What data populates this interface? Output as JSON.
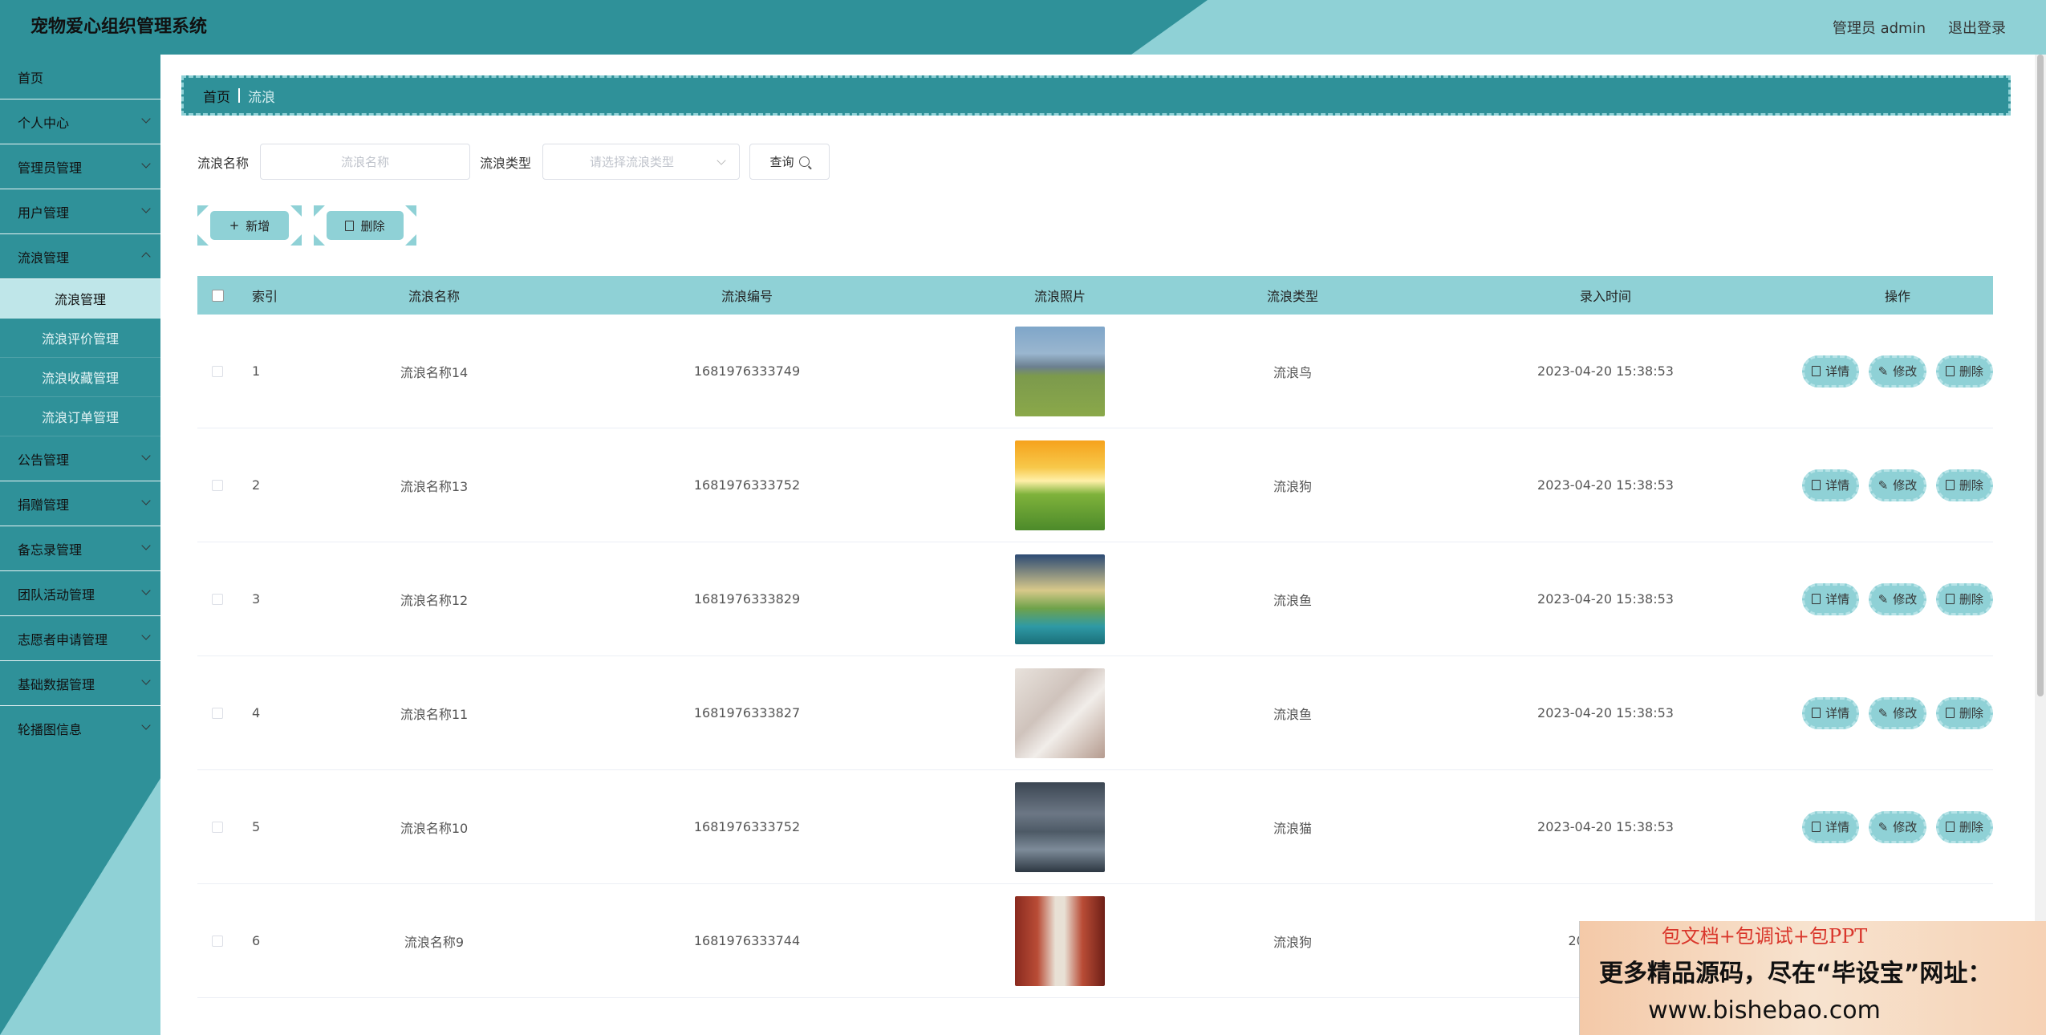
{
  "header": {
    "title": "宠物爱心组织管理系统",
    "user": "管理员 admin",
    "logout": "退出登录"
  },
  "sidebar": {
    "items": [
      {
        "label": "首页"
      },
      {
        "label": "个人中心"
      },
      {
        "label": "管理员管理"
      },
      {
        "label": "用户管理"
      },
      {
        "label": "流浪管理"
      }
    ],
    "sub_items": [
      {
        "label": "流浪管理"
      },
      {
        "label": "流浪评价管理"
      },
      {
        "label": "流浪收藏管理"
      },
      {
        "label": "流浪订单管理"
      }
    ],
    "items_after": [
      {
        "label": "公告管理"
      },
      {
        "label": "捐赠管理"
      },
      {
        "label": "备忘录管理"
      },
      {
        "label": "团队活动管理"
      },
      {
        "label": "志愿者申请管理"
      },
      {
        "label": "基础数据管理"
      },
      {
        "label": "轮播图信息"
      }
    ]
  },
  "breadcrumb": {
    "home": "首页",
    "current": "流浪"
  },
  "search": {
    "name_label": "流浪名称",
    "name_placeholder": "流浪名称",
    "type_label": "流浪类型",
    "type_placeholder": "请选择流浪类型",
    "query_label": "查询"
  },
  "actions": {
    "add_label": "新增",
    "delete_label": "删除"
  },
  "table": {
    "headers": [
      "索引",
      "流浪名称",
      "流浪编号",
      "流浪照片",
      "流浪类型",
      "录入时间",
      "操作"
    ],
    "op_labels": {
      "detail": "详情",
      "edit": "修改",
      "delete": "删除"
    },
    "rows": [
      {
        "idx": "1",
        "name": "流浪名称14",
        "code": "1681976333749",
        "type": "流浪鸟",
        "time": "2023-04-20 15:38:53",
        "img": "mountain-meadow"
      },
      {
        "idx": "2",
        "name": "流浪名称13",
        "code": "1681976333752",
        "type": "流浪狗",
        "time": "2023-04-20 15:38:53",
        "img": "sunset-flowers"
      },
      {
        "idx": "3",
        "name": "流浪名称12",
        "code": "1681976333829",
        "type": "流浪鱼",
        "time": "2023-04-20 15:38:53",
        "img": "lake-sunrise"
      },
      {
        "idx": "4",
        "name": "流浪名称11",
        "code": "1681976333827",
        "type": "流浪鱼",
        "time": "2023-04-20 15:38:53",
        "img": "blossom-branch"
      },
      {
        "idx": "5",
        "name": "流浪名称10",
        "code": "1681976333752",
        "type": "流浪猫",
        "time": "2023-04-20 15:38:53",
        "img": "lakeside-town"
      },
      {
        "idx": "6",
        "name": "流浪名称9",
        "code": "1681976333744",
        "type": "流浪狗",
        "time": "2023-04-20",
        "img": "red-corridor"
      }
    ]
  },
  "ad": {
    "line1": "包文档+包调试+包PPT",
    "line2": "更多精品源码，尽在“毕设宝”网址：",
    "line3": "www.bishebao.com"
  }
}
